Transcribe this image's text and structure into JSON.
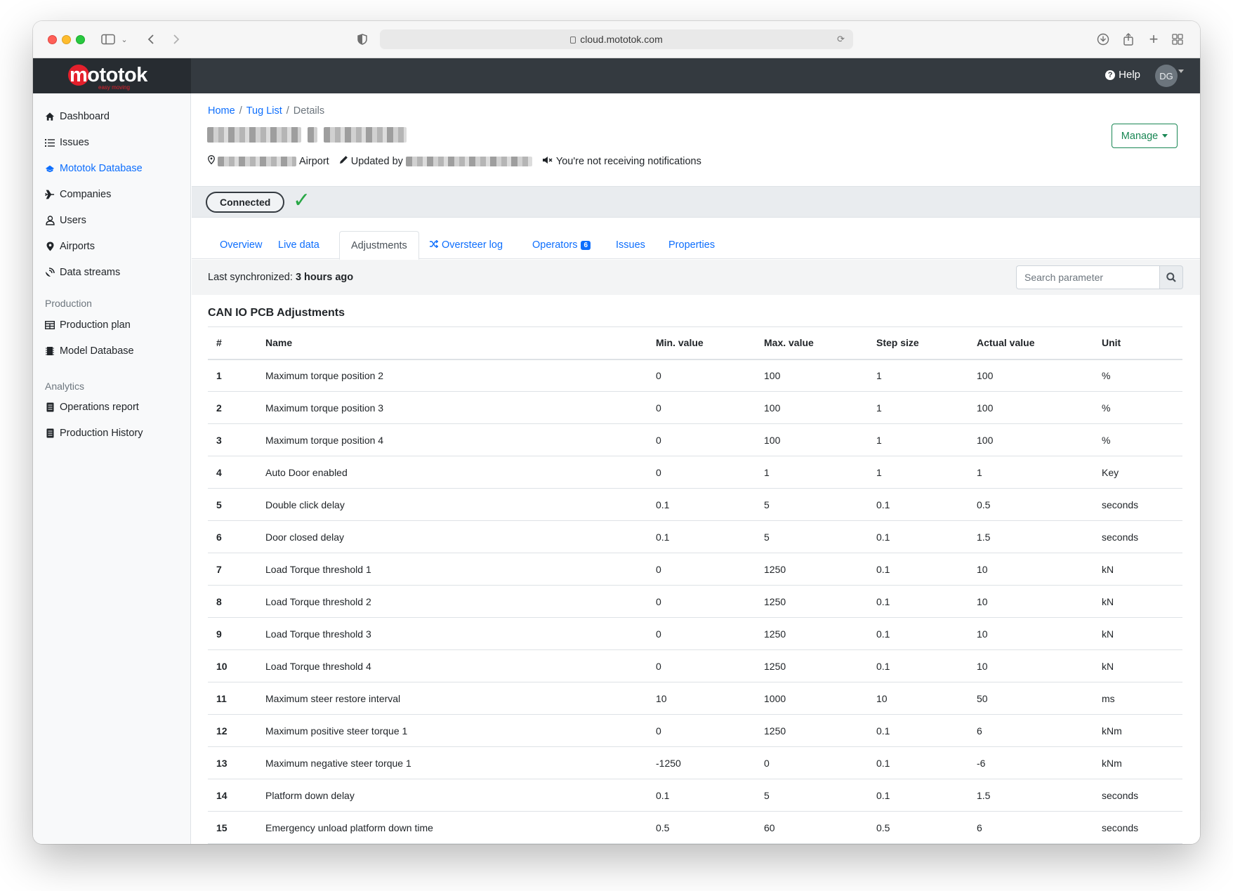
{
  "browser": {
    "url": "cloud.mototok.com"
  },
  "header": {
    "logo_text": "mototok",
    "logo_tagline": "easy moving",
    "help_label": "Help",
    "avatar_initials": "DG"
  },
  "sidebar": {
    "items": [
      {
        "label": "Dashboard",
        "icon": "home-icon"
      },
      {
        "label": "Issues",
        "icon": "list-icon"
      },
      {
        "label": "Mototok Database",
        "icon": "database-icon",
        "active": true
      },
      {
        "label": "Companies",
        "icon": "plane-icon"
      },
      {
        "label": "Users",
        "icon": "user-icon"
      },
      {
        "label": "Airports",
        "icon": "map-marker-icon"
      },
      {
        "label": "Data streams",
        "icon": "satellite-dish-icon"
      }
    ],
    "production_heading": "Production",
    "production_items": [
      {
        "label": "Production plan",
        "icon": "table-icon"
      },
      {
        "label": "Model Database",
        "icon": "chip-icon"
      }
    ],
    "analytics_heading": "Analytics",
    "analytics_items": [
      {
        "label": "Operations report",
        "icon": "report-icon"
      },
      {
        "label": "Production History",
        "icon": "report-icon"
      }
    ]
  },
  "breadcrumb": {
    "home": "Home",
    "list": "Tug List",
    "current": "Details"
  },
  "details": {
    "airport_suffix": "Airport",
    "updated_by_label": "Updated by",
    "notifications_text": "You're not receiving notifications",
    "manage_label": "Manage",
    "status_label": "Connected",
    "status_check": "✓"
  },
  "tabs": [
    {
      "label": "Overview"
    },
    {
      "label": "Live data"
    },
    {
      "label": "Adjustments",
      "active": true
    },
    {
      "label": "Oversteer log",
      "icon": "shuffle-icon"
    },
    {
      "label": "Operators",
      "badge": "6"
    },
    {
      "label": "Issues"
    },
    {
      "label": "Properties"
    }
  ],
  "sync": {
    "label": "Last synchronized:",
    "value": "3 hours ago",
    "search_placeholder": "Search parameter"
  },
  "table": {
    "title": "CAN IO PCB Adjustments",
    "columns": [
      "#",
      "Name",
      "Min. value",
      "Max. value",
      "Step size",
      "Actual value",
      "Unit"
    ],
    "rows": [
      [
        "1",
        "Maximum torque position 2",
        "0",
        "100",
        "1",
        "100",
        "%"
      ],
      [
        "2",
        "Maximum torque position 3",
        "0",
        "100",
        "1",
        "100",
        "%"
      ],
      [
        "3",
        "Maximum torque position 4",
        "0",
        "100",
        "1",
        "100",
        "%"
      ],
      [
        "4",
        "Auto Door enabled",
        "0",
        "1",
        "1",
        "1",
        "Key"
      ],
      [
        "5",
        "Double click delay",
        "0.1",
        "5",
        "0.1",
        "0.5",
        "seconds"
      ],
      [
        "6",
        "Door closed delay",
        "0.1",
        "5",
        "0.1",
        "1.5",
        "seconds"
      ],
      [
        "7",
        "Load Torque threshold 1",
        "0",
        "1250",
        "0.1",
        "10",
        "kN"
      ],
      [
        "8",
        "Load Torque threshold 2",
        "0",
        "1250",
        "0.1",
        "10",
        "kN"
      ],
      [
        "9",
        "Load Torque threshold 3",
        "0",
        "1250",
        "0.1",
        "10",
        "kN"
      ],
      [
        "10",
        "Load Torque threshold 4",
        "0",
        "1250",
        "0.1",
        "10",
        "kN"
      ],
      [
        "11",
        "Maximum steer restore interval",
        "10",
        "1000",
        "10",
        "50",
        "ms"
      ],
      [
        "12",
        "Maximum positive steer torque 1",
        "0",
        "1250",
        "0.1",
        "6",
        "kNm"
      ],
      [
        "13",
        "Maximum negative steer torque 1",
        "-1250",
        "0",
        "0.1",
        "-6",
        "kNm"
      ],
      [
        "14",
        "Platform down delay",
        "0.1",
        "5",
        "0.1",
        "1.5",
        "seconds"
      ],
      [
        "15",
        "Emergency unload platform down time",
        "0.5",
        "60",
        "0.5",
        "6",
        "seconds"
      ]
    ]
  }
}
